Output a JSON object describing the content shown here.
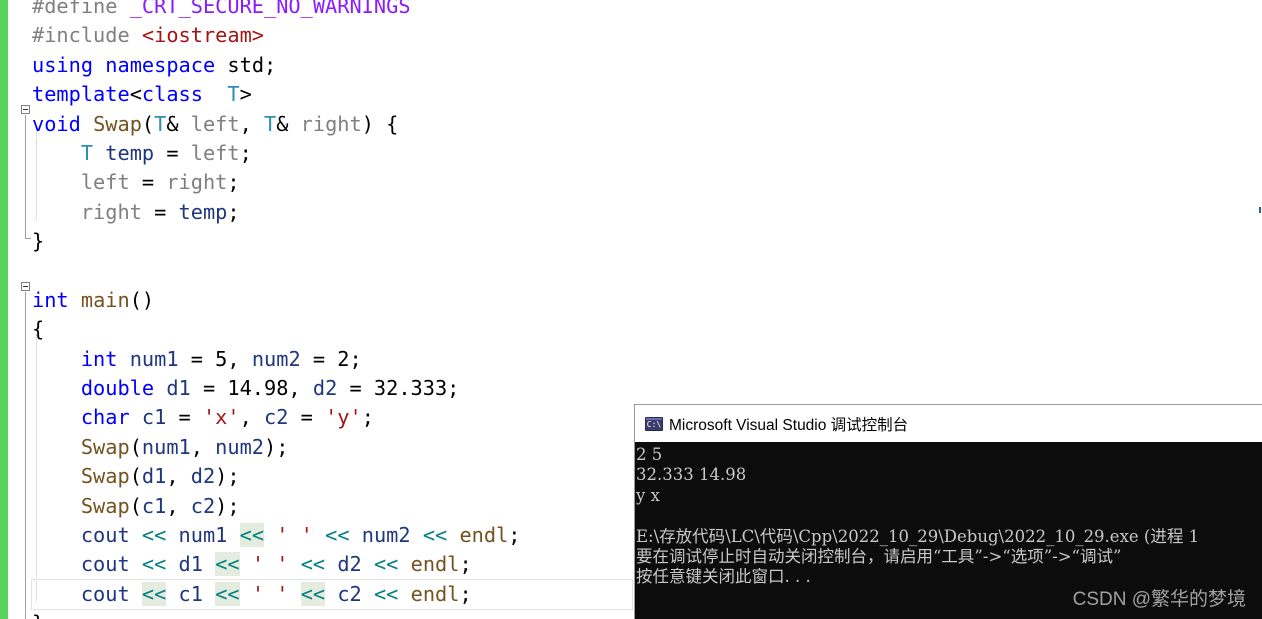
{
  "editor": {
    "lines": [
      {
        "tokens": [
          {
            "t": "#define ",
            "c": "pp"
          },
          {
            "t": "_CRT_SECURE_NO_WARNINGS",
            "c": "macro"
          }
        ]
      },
      {
        "tokens": [
          {
            "t": "#include ",
            "c": "pp"
          },
          {
            "t": "<iostream>",
            "c": "str"
          }
        ]
      },
      {
        "tokens": [
          {
            "t": "using",
            "c": "kw"
          },
          {
            "t": " ",
            "c": ""
          },
          {
            "t": "namespace",
            "c": "kw"
          },
          {
            "t": " std;",
            "c": ""
          }
        ]
      },
      {
        "tokens": [
          {
            "t": "template",
            "c": "kw"
          },
          {
            "t": "<",
            "c": ""
          },
          {
            "t": "class",
            "c": "kw"
          },
          {
            "t": "  ",
            "c": ""
          },
          {
            "t": "T",
            "c": "tp"
          },
          {
            "t": ">",
            "c": ""
          }
        ]
      },
      {
        "tokens": [
          {
            "t": "void",
            "c": "kw"
          },
          {
            "t": " ",
            "c": ""
          },
          {
            "t": "Swap",
            "c": "fn"
          },
          {
            "t": "(",
            "c": ""
          },
          {
            "t": "T",
            "c": "tp"
          },
          {
            "t": "& ",
            "c": ""
          },
          {
            "t": "left",
            "c": "par"
          },
          {
            "t": ", ",
            "c": ""
          },
          {
            "t": "T",
            "c": "tp"
          },
          {
            "t": "& ",
            "c": ""
          },
          {
            "t": "right",
            "c": "par"
          },
          {
            "t": ") {",
            "c": ""
          }
        ]
      },
      {
        "tokens": [
          {
            "t": "    ",
            "c": ""
          },
          {
            "t": "T",
            "c": "tp"
          },
          {
            "t": " ",
            "c": ""
          },
          {
            "t": "temp",
            "c": "loc"
          },
          {
            "t": " = ",
            "c": ""
          },
          {
            "t": "left",
            "c": "par"
          },
          {
            "t": ";",
            "c": ""
          }
        ]
      },
      {
        "tokens": [
          {
            "t": "    ",
            "c": ""
          },
          {
            "t": "left",
            "c": "par"
          },
          {
            "t": " = ",
            "c": ""
          },
          {
            "t": "right",
            "c": "par"
          },
          {
            "t": ";",
            "c": ""
          }
        ]
      },
      {
        "tokens": [
          {
            "t": "    ",
            "c": ""
          },
          {
            "t": "right",
            "c": "par"
          },
          {
            "t": " = ",
            "c": ""
          },
          {
            "t": "temp",
            "c": "loc"
          },
          {
            "t": ";",
            "c": ""
          }
        ]
      },
      {
        "tokens": [
          {
            "t": "}",
            "c": ""
          }
        ]
      },
      {
        "tokens": [
          {
            "t": "",
            "c": ""
          }
        ]
      },
      {
        "tokens": [
          {
            "t": "int",
            "c": "kw"
          },
          {
            "t": " ",
            "c": ""
          },
          {
            "t": "main",
            "c": "fn"
          },
          {
            "t": "()",
            "c": ""
          }
        ]
      },
      {
        "tokens": [
          {
            "t": "{",
            "c": ""
          }
        ]
      },
      {
        "tokens": [
          {
            "t": "    ",
            "c": ""
          },
          {
            "t": "int",
            "c": "kw"
          },
          {
            "t": " ",
            "c": ""
          },
          {
            "t": "num1",
            "c": "loc"
          },
          {
            "t": " = 5, ",
            "c": ""
          },
          {
            "t": "num2",
            "c": "loc"
          },
          {
            "t": " = 2;",
            "c": ""
          }
        ]
      },
      {
        "tokens": [
          {
            "t": "    ",
            "c": ""
          },
          {
            "t": "double",
            "c": "kw"
          },
          {
            "t": " ",
            "c": ""
          },
          {
            "t": "d1",
            "c": "loc"
          },
          {
            "t": " = 14.98, ",
            "c": ""
          },
          {
            "t": "d2",
            "c": "loc"
          },
          {
            "t": " = 32.333;",
            "c": ""
          }
        ]
      },
      {
        "tokens": [
          {
            "t": "    ",
            "c": ""
          },
          {
            "t": "char",
            "c": "kw"
          },
          {
            "t": " ",
            "c": ""
          },
          {
            "t": "c1",
            "c": "loc"
          },
          {
            "t": " = ",
            "c": ""
          },
          {
            "t": "'x'",
            "c": "str"
          },
          {
            "t": ", ",
            "c": ""
          },
          {
            "t": "c2",
            "c": "loc"
          },
          {
            "t": " = ",
            "c": ""
          },
          {
            "t": "'y'",
            "c": "str"
          },
          {
            "t": ";",
            "c": ""
          }
        ]
      },
      {
        "tokens": [
          {
            "t": "    ",
            "c": ""
          },
          {
            "t": "Swap",
            "c": "fn"
          },
          {
            "t": "(",
            "c": ""
          },
          {
            "t": "num1",
            "c": "loc"
          },
          {
            "t": ", ",
            "c": ""
          },
          {
            "t": "num2",
            "c": "loc"
          },
          {
            "t": ");",
            "c": ""
          }
        ]
      },
      {
        "tokens": [
          {
            "t": "    ",
            "c": ""
          },
          {
            "t": "Swap",
            "c": "fn"
          },
          {
            "t": "(",
            "c": ""
          },
          {
            "t": "d1",
            "c": "loc"
          },
          {
            "t": ", ",
            "c": ""
          },
          {
            "t": "d2",
            "c": "loc"
          },
          {
            "t": ");",
            "c": ""
          }
        ]
      },
      {
        "tokens": [
          {
            "t": "    ",
            "c": ""
          },
          {
            "t": "Swap",
            "c": "fn"
          },
          {
            "t": "(",
            "c": ""
          },
          {
            "t": "c1",
            "c": "loc"
          },
          {
            "t": ", ",
            "c": ""
          },
          {
            "t": "c2",
            "c": "loc"
          },
          {
            "t": ");",
            "c": ""
          }
        ]
      },
      {
        "tokens": [
          {
            "t": "    ",
            "c": ""
          },
          {
            "t": "cout",
            "c": "loc"
          },
          {
            "t": " ",
            "c": ""
          },
          {
            "t": "<<",
            "c": "op"
          },
          {
            "t": " ",
            "c": ""
          },
          {
            "t": "num1",
            "c": "loc"
          },
          {
            "t": " ",
            "c": ""
          },
          {
            "t": "<<",
            "c": "op hl"
          },
          {
            "t": " ",
            "c": ""
          },
          {
            "t": "' '",
            "c": "str"
          },
          {
            "t": " ",
            "c": ""
          },
          {
            "t": "<<",
            "c": "op"
          },
          {
            "t": " ",
            "c": ""
          },
          {
            "t": "num2",
            "c": "loc"
          },
          {
            "t": " ",
            "c": ""
          },
          {
            "t": "<<",
            "c": "op"
          },
          {
            "t": " ",
            "c": ""
          },
          {
            "t": "endl",
            "c": "fn"
          },
          {
            "t": ";",
            "c": ""
          }
        ]
      },
      {
        "tokens": [
          {
            "t": "    ",
            "c": ""
          },
          {
            "t": "cout",
            "c": "loc"
          },
          {
            "t": " ",
            "c": ""
          },
          {
            "t": "<<",
            "c": "op"
          },
          {
            "t": " ",
            "c": ""
          },
          {
            "t": "d1",
            "c": "loc"
          },
          {
            "t": " ",
            "c": ""
          },
          {
            "t": "<<",
            "c": "op hl"
          },
          {
            "t": " ",
            "c": ""
          },
          {
            "t": "' '",
            "c": "str"
          },
          {
            "t": " ",
            "c": ""
          },
          {
            "t": "<<",
            "c": "op"
          },
          {
            "t": " ",
            "c": ""
          },
          {
            "t": "d2",
            "c": "loc"
          },
          {
            "t": " ",
            "c": ""
          },
          {
            "t": "<<",
            "c": "op"
          },
          {
            "t": " ",
            "c": ""
          },
          {
            "t": "endl",
            "c": "fn"
          },
          {
            "t": ";",
            "c": ""
          }
        ]
      },
      {
        "tokens": [
          {
            "t": "    ",
            "c": ""
          },
          {
            "t": "cout",
            "c": "loc"
          },
          {
            "t": " ",
            "c": ""
          },
          {
            "t": "<<",
            "c": "op hl"
          },
          {
            "t": " ",
            "c": ""
          },
          {
            "t": "c1",
            "c": "loc"
          },
          {
            "t": " ",
            "c": ""
          },
          {
            "t": "<<",
            "c": "op hl"
          },
          {
            "t": " ",
            "c": ""
          },
          {
            "t": "' '",
            "c": "str"
          },
          {
            "t": " ",
            "c": ""
          },
          {
            "t": "<<",
            "c": "op hl"
          },
          {
            "t": " ",
            "c": ""
          },
          {
            "t": "c2",
            "c": "loc"
          },
          {
            "t": " ",
            "c": ""
          },
          {
            "t": "<<",
            "c": "op"
          },
          {
            "t": " ",
            "c": ""
          },
          {
            "t": "endl",
            "c": "fn"
          },
          {
            "t": ";",
            "c": ""
          }
        ],
        "current": true
      },
      {
        "tokens": [
          {
            "t": "}",
            "c": ""
          }
        ]
      }
    ]
  },
  "console": {
    "title": "Microsoft Visual Studio 调试控制台",
    "icon_label": "C:\\",
    "lines": [
      "2 5",
      "32.333 14.98",
      "y x",
      "",
      "E:\\存放代码\\LC\\代码\\Cpp\\2022_10_29\\Debug\\2022_10_29.exe (进程 1",
      "要在调试停止时自动关闭控制台，请启用“工具”->“选项”->“调试”",
      "按任意键关闭此窗口. . ."
    ]
  },
  "watermark": "CSDN @繁华的梦境",
  "colors": {
    "keyword": "#0000ff",
    "preprocessor": "#808080",
    "string": "#a31515",
    "type": "#2b91af",
    "function": "#74531f",
    "parameter": "#808080",
    "local": "#1f377f",
    "operator": "#008080",
    "change_bar": "#57d45a",
    "console_bg": "#0c0c0c"
  }
}
